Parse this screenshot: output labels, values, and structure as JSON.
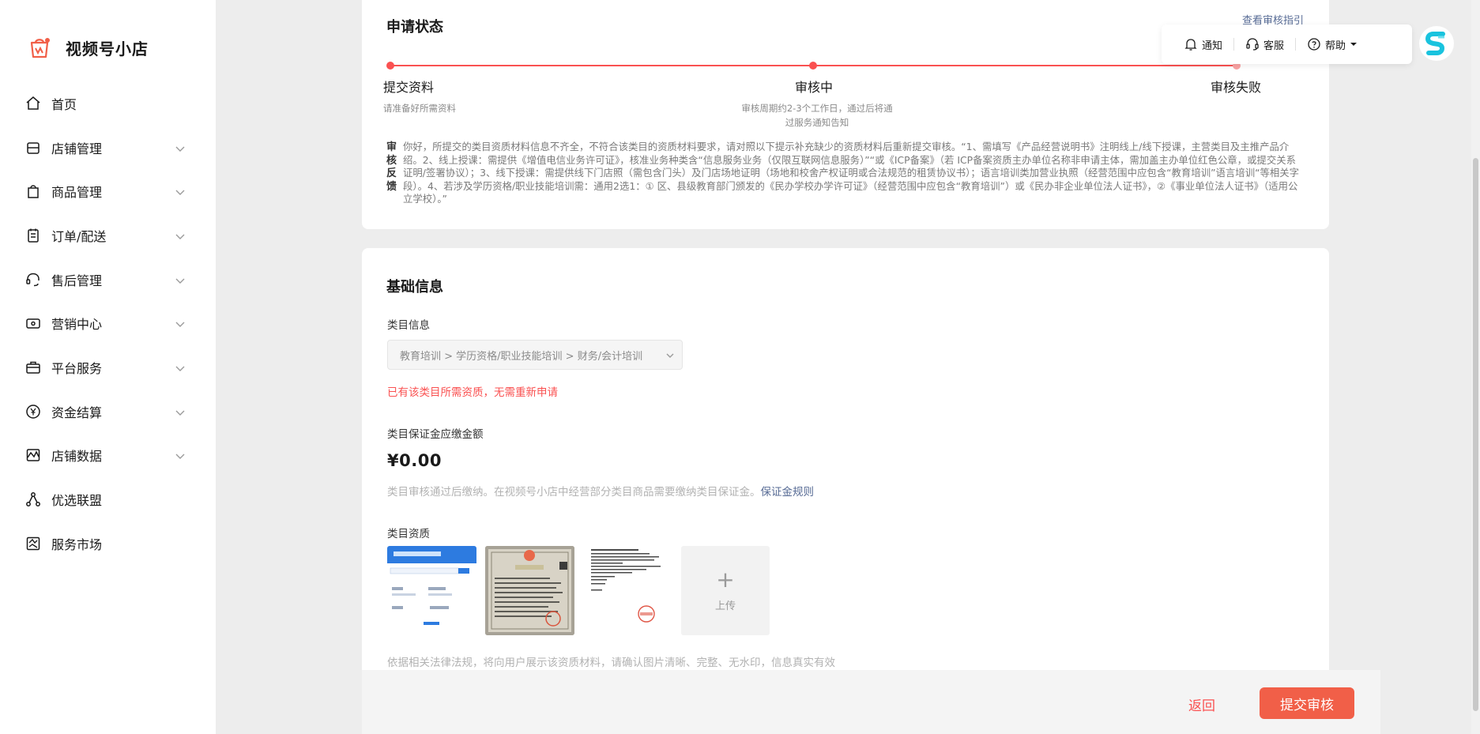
{
  "app": {
    "name": "视频号小店"
  },
  "sidebar": {
    "items": [
      {
        "label": "首页",
        "icon": "home-icon",
        "expandable": false
      },
      {
        "label": "店铺管理",
        "icon": "store-icon",
        "expandable": true
      },
      {
        "label": "商品管理",
        "icon": "bag-icon",
        "expandable": true
      },
      {
        "label": "订单/配送",
        "icon": "order-icon",
        "expandable": true
      },
      {
        "label": "售后管理",
        "icon": "headset-icon",
        "expandable": true
      },
      {
        "label": "营销中心",
        "icon": "ticket-icon",
        "expandable": true
      },
      {
        "label": "平台服务",
        "icon": "briefcase-icon",
        "expandable": true
      },
      {
        "label": "资金结算",
        "icon": "yen-icon",
        "expandable": true
      },
      {
        "label": "店铺数据",
        "icon": "chart-icon",
        "expandable": true
      },
      {
        "label": "优选联盟",
        "icon": "network-icon",
        "expandable": false
      },
      {
        "label": "服务市场",
        "icon": "market-icon",
        "expandable": false
      }
    ]
  },
  "toolbar": {
    "notify": "通知",
    "service": "客服",
    "help": "帮助"
  },
  "status": {
    "title": "申请状态",
    "guide_link": "查看审核指引",
    "steps": [
      {
        "title": "提交资料",
        "sub": "请准备好所需资料"
      },
      {
        "title": "审核中",
        "sub1": "审核周期约2-3个工作日，通过后将通",
        "sub2": "过服务通知告知"
      },
      {
        "title": "审核失败"
      }
    ],
    "feedback_label": "审核反馈",
    "feedback_text": "你好，所提交的类目资质材料信息不齐全，不符合该类目的资质材料要求，请对照以下提示补充缺少的资质材料后重新提交审核。“1、需填写《产品经营说明书》注明线上/线下授课，主营类目及主推产品介绍。2、线上授课：需提供《增值电信业务许可证》，核准业务种类含“信息服务业务（仅限互联网信息服务）”“或《ICP备案》（若 ICP备案资质主办单位名称非申请主体，需加盖主办单位红色公章，或提交关系证明/签署协议）；3、线下授课：需提供线下门店照（需包含门头）及门店场地证明（场地和校舍产权证明或合法规范的租赁协议书）；语言培训类加营业执照（经营范围中应包含“教育培训”语言培训“等相关字段）。4、若涉及学历资格/职业技能培训需：通用2选1：① 区、县级教育部门颁发的《民办学校办学许可证》（经营范围中应包含“教育培训”）或《民办非企业单位法人证书》，②《事业单位法人证书》（适用公立学校）。”"
  },
  "basic": {
    "title": "基础信息",
    "category_label": "类目信息",
    "category_value": "教育培训 > 学历资格/职业技能培训 > 财务/会计培训",
    "category_warning": "已有该类目所需资质，无需重新申请",
    "deposit_label": "类目保证金应缴金额",
    "deposit_amount": "¥0.00",
    "deposit_hint": "类目审核通过后缴纳。在视频号小店中经营部分类目商品需要缴纳类目保证金。",
    "deposit_rule_link": "保证金规则",
    "qualification_label": "类目资质",
    "upload_label": "上传",
    "qualification_hint": "依据相关法律法规，将向用户展示该资质材料，请确认图片清晰、完整、无水印，信息真实有效"
  },
  "footer": {
    "back_label": "返回",
    "submit_label": "提交审核"
  },
  "colors": {
    "accent_red": "#fa5151",
    "submit_orange": "#f15f48",
    "link_blue": "#576b95",
    "brand_cyan": "#19c3de"
  }
}
